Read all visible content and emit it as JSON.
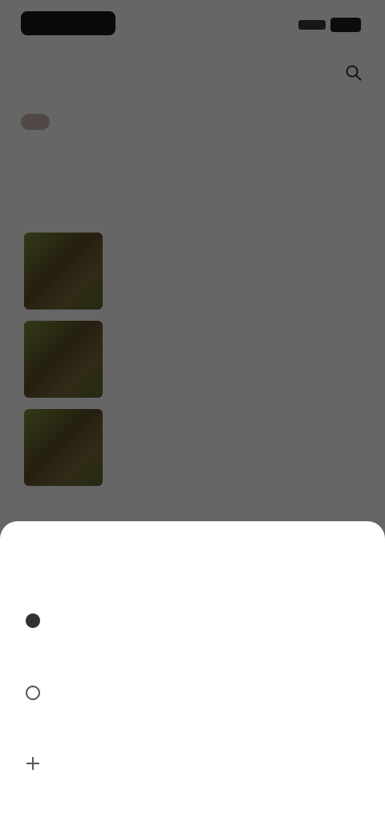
{
  "header": {
    "title": ""
  },
  "chips": [
    {
      "label": ""
    },
    {
      "label": ""
    }
  ],
  "section": {
    "heading": ""
  },
  "items": [
    {
      "title": "",
      "subtitle": "",
      "meta": ""
    },
    {
      "title": "",
      "subtitle": "",
      "meta": ""
    },
    {
      "title": "",
      "subtitle": "",
      "meta": ""
    }
  ],
  "sheet": {
    "title": "",
    "options": [
      {
        "icon": "circle-icon",
        "label": ""
      },
      {
        "icon": "circle-outline-icon",
        "label": ""
      },
      {
        "icon": "plus-icon",
        "label": ""
      }
    ]
  },
  "colors": {
    "scrim": "#000000",
    "chip_active_bg": "#c9b6ae",
    "sheet_bg": "#ffffff"
  }
}
